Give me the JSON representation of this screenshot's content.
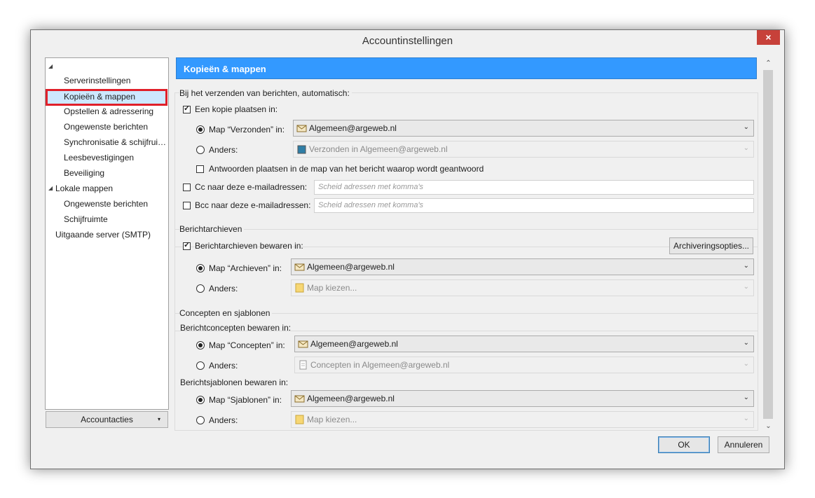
{
  "window": {
    "title": "Accountinstellingen",
    "close_label": "×"
  },
  "tree": {
    "root_toggle": "◢",
    "items": [
      {
        "label": "Serverinstellingen"
      },
      {
        "label": "Kopieën & mappen"
      },
      {
        "label": "Opstellen & adressering"
      },
      {
        "label": "Ongewenste berichten"
      },
      {
        "label": "Synchronisatie & schijfrui…"
      },
      {
        "label": "Leesbevestigingen"
      },
      {
        "label": "Beveiliging"
      },
      {
        "label": "Lokale mappen"
      },
      {
        "label": "Ongewenste berichten"
      },
      {
        "label": "Schijfruimte"
      },
      {
        "label": "Uitgaande server (SMTP)"
      }
    ],
    "account_actions": "Accountacties"
  },
  "header": "Kopieën & mappen",
  "sending": {
    "group_label": "Bij het verzenden van berichten, automatisch:",
    "copy_label": "Een kopie plaatsen in:",
    "sent_radio": "Map “Verzonden” in:",
    "sent_value": "Algemeen@argeweb.nl",
    "other_radio": "Anders:",
    "other_value": "Verzonden in Algemeen@argeweb.nl",
    "reply_label": "Antwoorden plaatsen in de map van het bericht waarop wordt geantwoord",
    "cc_label": "Cc naar deze e-mailadressen:",
    "cc_placeholder": "Scheid adressen met komma's",
    "bcc_label": "Bcc naar deze e-mailadressen:",
    "bcc_placeholder": "Scheid adressen met komma's"
  },
  "archives": {
    "group_label": "Berichtarchieven",
    "keep_label": "Berichtarchieven bewaren in:",
    "options_button": "Archiveringsopties...",
    "archive_radio": "Map “Archieven” in:",
    "archive_value": "Algemeen@argeweb.nl",
    "other_radio": "Anders:",
    "other_value": "Map kiezen..."
  },
  "drafts": {
    "group_label": "Concepten en sjablonen",
    "drafts_label": "Berichtconcepten bewaren in:",
    "drafts_radio": "Map “Concepten” in:",
    "drafts_value": "Algemeen@argeweb.nl",
    "drafts_other_radio": "Anders:",
    "drafts_other_value": "Concepten in Algemeen@argeweb.nl",
    "templates_label": "Berichtsjablonen bewaren in:",
    "templates_radio": "Map “Sjablonen” in:",
    "templates_value": "Algemeen@argeweb.nl",
    "templates_other_radio": "Anders:",
    "templates_other_value": "Map kiezen..."
  },
  "footer": {
    "ok": "OK",
    "cancel": "Annuleren"
  },
  "colors": {
    "header_bg": "#3399ff",
    "selection_border": "#e0202a",
    "close_bg": "#c7413a"
  }
}
